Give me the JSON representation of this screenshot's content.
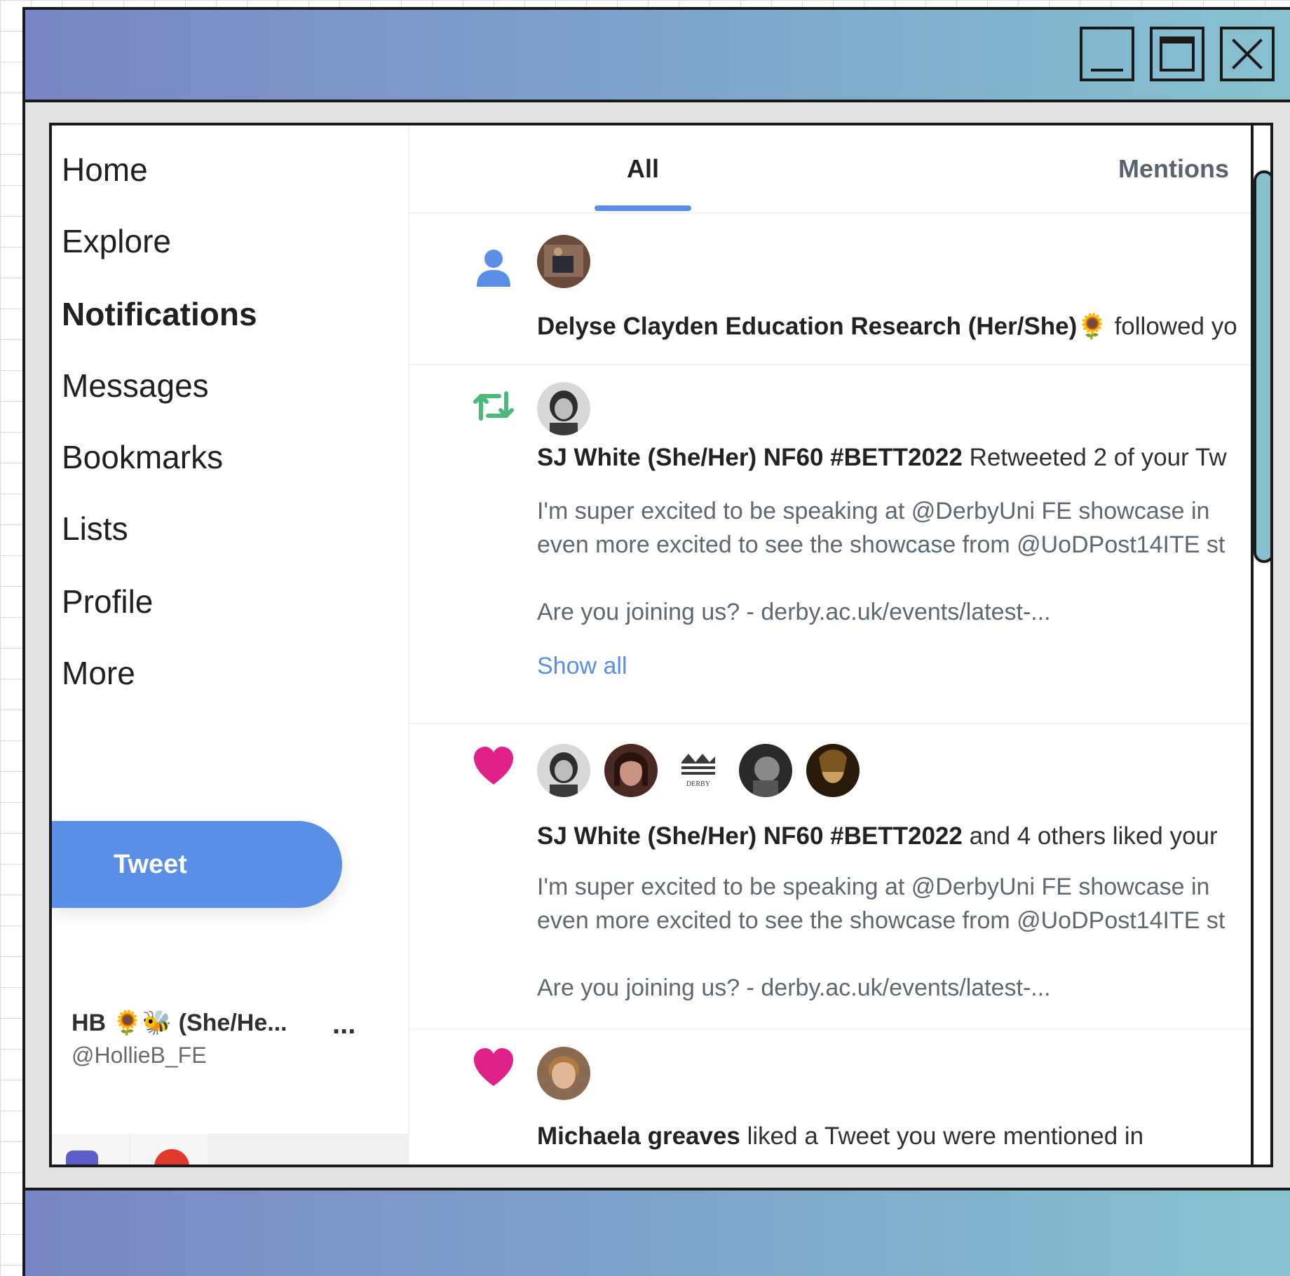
{
  "sidebar": {
    "nav": [
      {
        "label": "Home"
      },
      {
        "label": "Explore"
      },
      {
        "label": "Notifications",
        "active": true
      },
      {
        "label": "Messages"
      },
      {
        "label": "Bookmarks"
      },
      {
        "label": "Lists"
      },
      {
        "label": "Profile"
      },
      {
        "label": "More"
      }
    ],
    "tweet_label": "Tweet",
    "account": {
      "name": "HB 🌻🐝 (She/He...",
      "handle": "@HollieB_FE",
      "more": "..."
    }
  },
  "tabs": {
    "all": "All",
    "mentions": "Mentions"
  },
  "notifications": [
    {
      "type": "follow",
      "icon": "person-icon",
      "name": "Delyse Clayden Education Research (Her/She)🌻",
      "action": " followed yo"
    },
    {
      "type": "retweet",
      "icon": "retweet-icon",
      "name": "SJ White (She/Her) NF60 #BETT2022",
      "action": " Retweeted 2 of your Tw",
      "body": [
        "I'm super excited to be speaking at @DerbyUni  FE showcase in",
        "even more excited to see the showcase from @UoDPost14ITE st",
        "",
        "Are you joining us? - derby.ac.uk/events/latest-..."
      ],
      "show_all": "Show all"
    },
    {
      "type": "like",
      "icon": "heart-icon",
      "name": "SJ White (She/Her) NF60 #BETT2022",
      "action": " and 4 others liked your",
      "body": [
        "I'm super excited to be speaking at @DerbyUni  FE showcase in",
        "even more excited to see the showcase from @UoDPost14ITE st",
        "",
        "Are you joining us? - derby.ac.uk/events/latest-..."
      ],
      "avatar_logo_text": "DERBY"
    },
    {
      "type": "like",
      "icon": "heart-icon",
      "name": "Michaela greaves",
      "action": " liked a Tweet you were mentioned in"
    }
  ],
  "colors": {
    "accent": "#5b8ee7",
    "retweet": "#4cb87a",
    "like": "#e0218a",
    "titlebar_start": "#7a86c4",
    "titlebar_end": "#88c2d0"
  }
}
